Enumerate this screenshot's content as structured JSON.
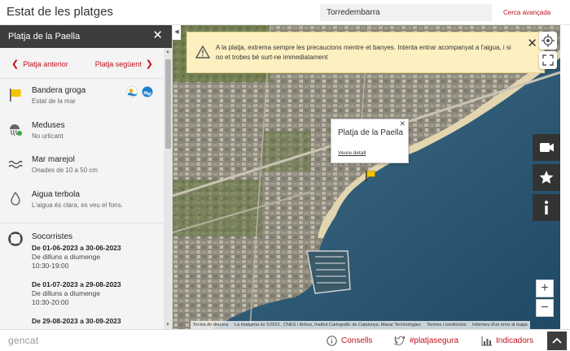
{
  "header": {
    "title": "Estat de les platges",
    "search_value": "Torredembarra",
    "advanced_search": "Cerca avançada"
  },
  "sidebar": {
    "title": "Platja de la Paella",
    "prev_label": "Platja anterior",
    "next_label": "Platja següent",
    "items": [
      {
        "title": "Bandera groga",
        "subtitle": "Estat de la mar",
        "icon": "yellow-flag-icon"
      },
      {
        "title": "Meduses",
        "subtitle": "No urticant",
        "icon": "jellyfish-icon"
      },
      {
        "title": "Mar marejol",
        "subtitle": "Onades de 10 a 50 cm",
        "icon": "waves-icon"
      },
      {
        "title": "Aigua terbola",
        "subtitle": "L'aigua és clara, es veu el fons.",
        "icon": "water-drop-icon"
      }
    ],
    "lifeguards": {
      "title": "Socorristes",
      "periods": [
        {
          "dates": "De 01-06-2023 a 30-06-2023",
          "days": "De dilluns a diumenge",
          "hours": "10:30-19:00"
        },
        {
          "dates": "De 01-07-2023 a 29-08-2023",
          "days": "De dilluns a diumenge",
          "hours": "10:30-20:00"
        },
        {
          "dates": "De 29-08-2023 a 30-09-2023",
          "days": "",
          "hours": ""
        }
      ]
    }
  },
  "map": {
    "alert_text": "A la platja, extrema sempre les precaucions mentre et banyes. Intenta entrar acompanyat a l'aigua, i si no et trobes bé surt-ne immediatament",
    "popup_title": "Platja de la Paella",
    "popup_link": "Veure detall",
    "attribution": [
      "Tecles de drecera",
      "La imatgeria és ©2023 , CNES / Airbus, Institut Cartogràfic de Catalunya, Maxar Technologies",
      "Termes i condicions",
      "Informeu d'un error al mapa"
    ],
    "zoom_in": "+",
    "zoom_out": "−"
  },
  "footer": {
    "logo": "gencat",
    "links": [
      "Consells",
      "#platjasegura",
      "Indicadors"
    ]
  },
  "colors": {
    "accent_red": "#c0111f",
    "dark": "#3d3d3d",
    "flag_yellow": "#f5c400",
    "alert_bg": "#fdf0c0"
  }
}
